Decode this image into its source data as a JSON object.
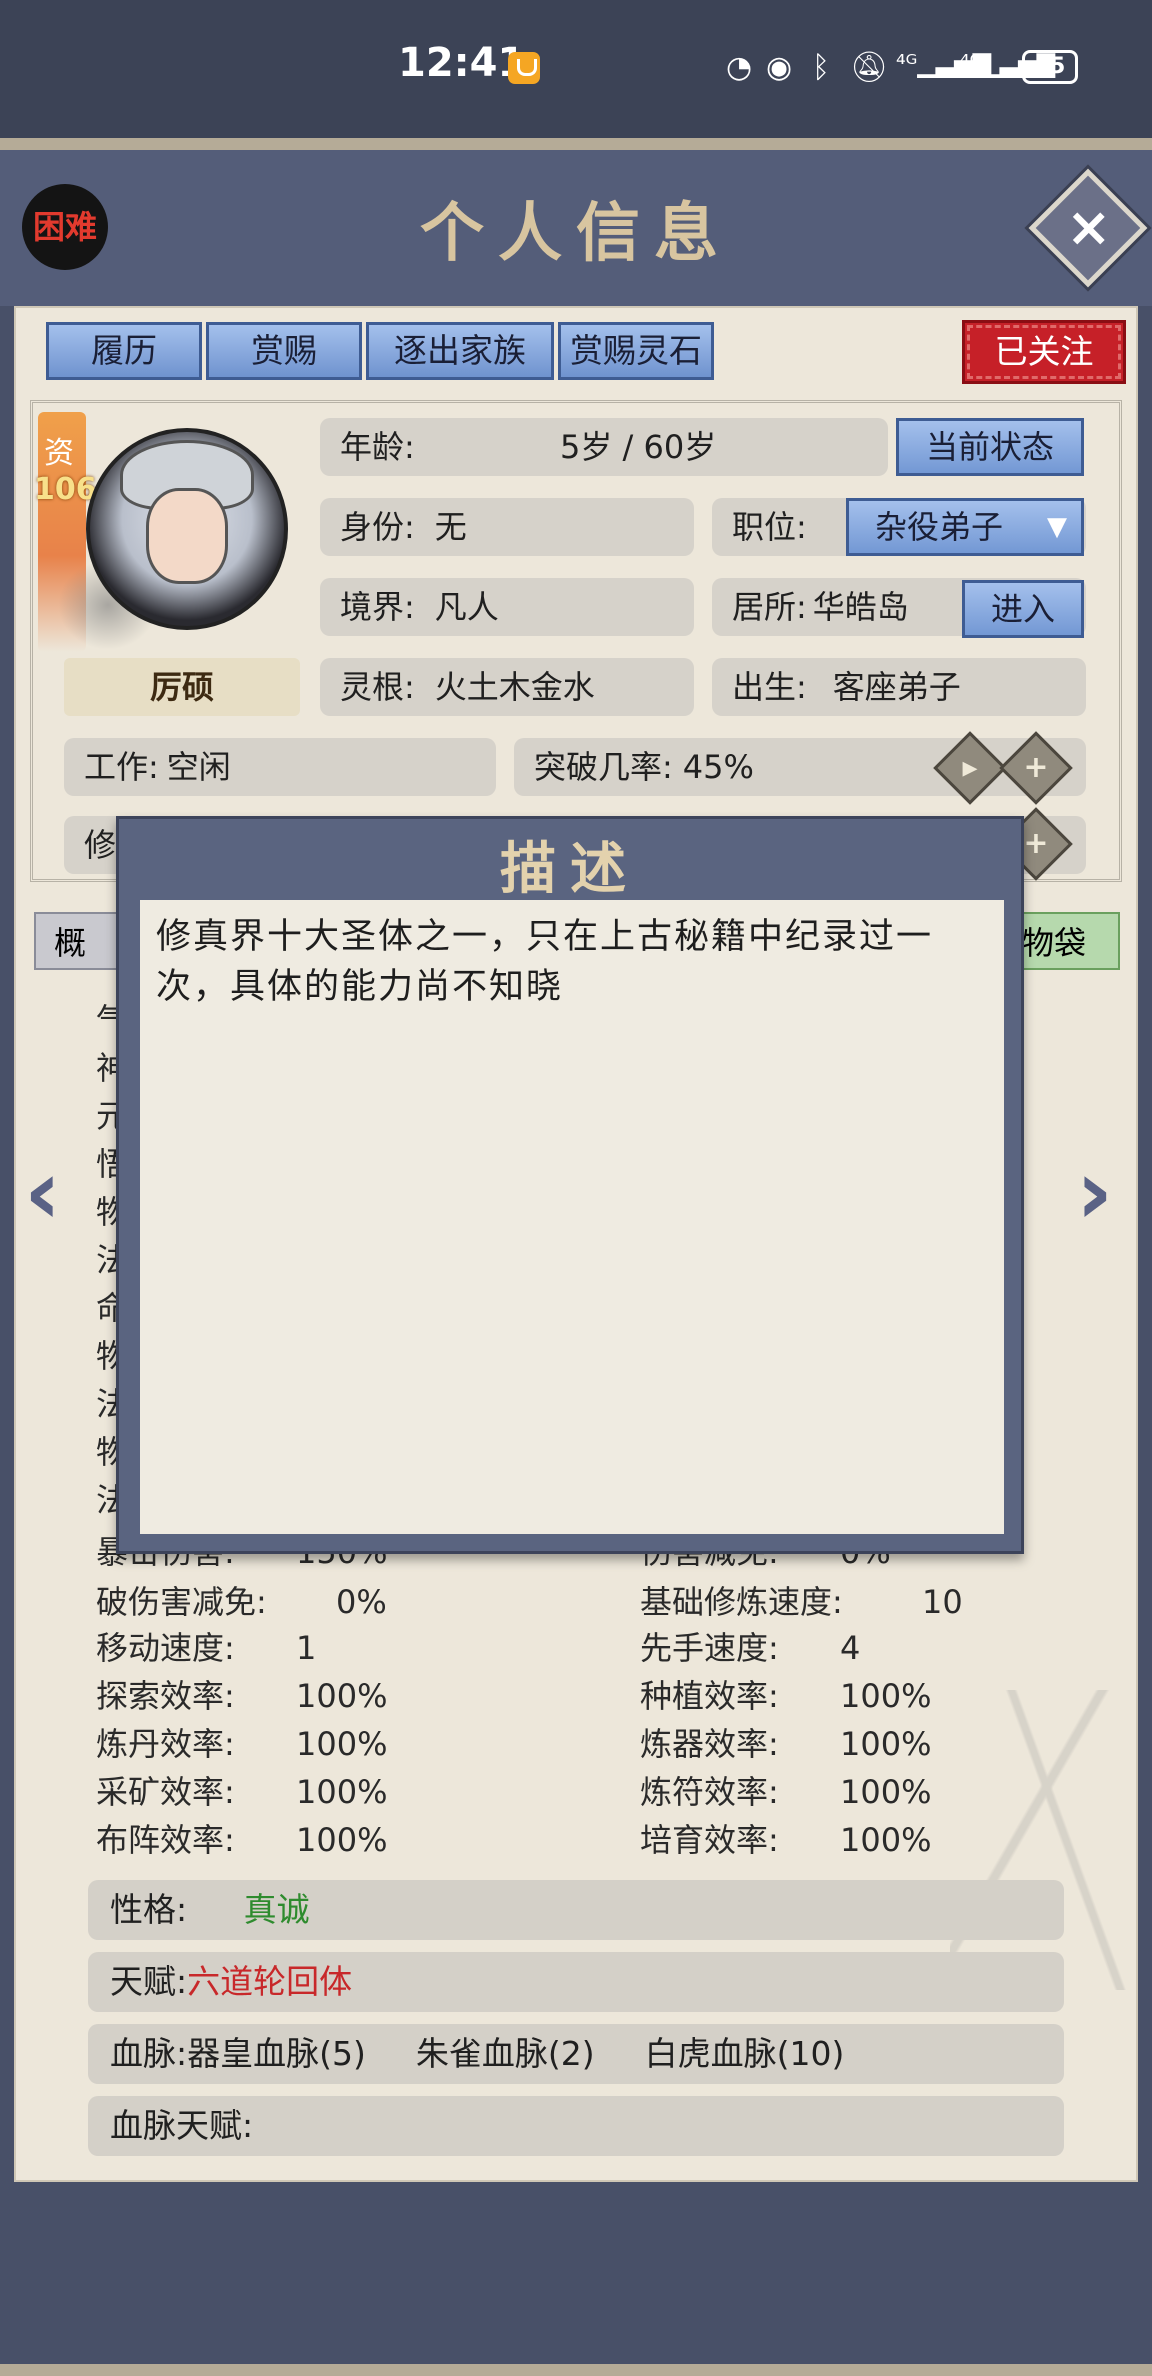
{
  "status_bar": {
    "time": "12:41",
    "battery": "65",
    "icons": [
      "speed-icon",
      "eye-icon",
      "bluetooth-icon",
      "mute-icon",
      "signal-4g-icon",
      "signal-4g-icon"
    ]
  },
  "header": {
    "title": "个人信息",
    "difficulty": "困难",
    "close_icon": "×"
  },
  "top_tabs": [
    "履历",
    "赏赐",
    "逐出家族",
    "赏赐灵石"
  ],
  "follow_button": "已关注",
  "character": {
    "aptitude_label": "资",
    "aptitude_value": "106",
    "trait_button": "厉硕",
    "age_label": "年龄:",
    "age_value": "5岁 / 60岁",
    "status_button": "当前状态",
    "identity_label": "身份:",
    "identity_value": "无",
    "position_label": "职位:",
    "position_value": "杂役弟子",
    "realm_label": "境界:",
    "realm_value": "凡人",
    "residence_label": "居所:",
    "residence_value": "华皓岛",
    "enter_button": "进入",
    "root_label": "灵根:",
    "root_value": "火土木金水",
    "birth_label": "出生:",
    "birth_value": "客座弟子",
    "work_label": "工作:",
    "work_value": "空闲",
    "breakthrough_label": "突破几率:",
    "breakthrough_value": "45%",
    "row6_label_partial": "修"
  },
  "lower_tabs": {
    "left_partial": "概",
    "right_partial": "物袋"
  },
  "stats_left_partial": [
    "气",
    "神",
    "元",
    "悟",
    "物",
    "法",
    "命",
    "物",
    "法",
    "物",
    "法"
  ],
  "stats": [
    {
      "l_label": "暴击伤害:",
      "l_value": "150%",
      "r_label": "伤害减免:",
      "r_value": "0%"
    },
    {
      "l_label": "破伤害减免:",
      "l_value": "0%",
      "r_label": "基础修炼速度:",
      "r_value": "10"
    },
    {
      "l_label": "移动速度:",
      "l_value": "1",
      "r_label": "先手速度:",
      "r_value": "4"
    },
    {
      "l_label": "探索效率:",
      "l_value": "100%",
      "r_label": "种植效率:",
      "r_value": "100%"
    },
    {
      "l_label": "炼丹效率:",
      "l_value": "100%",
      "r_label": "炼器效率:",
      "r_value": "100%"
    },
    {
      "l_label": "采矿效率:",
      "l_value": "100%",
      "r_label": "炼符效率:",
      "r_value": "100%"
    },
    {
      "l_label": "布阵效率:",
      "l_value": "100%",
      "r_label": "培育效率:",
      "r_value": "100%"
    }
  ],
  "bars": {
    "personality_label": "性格:",
    "personality_value": "真诚",
    "talent_label": "天赋:",
    "talent_value": "六道轮回体",
    "bloodline_label": "血脉:",
    "bloodline_1": "器皇血脉(5)",
    "bloodline_2": "朱雀血脉(2)",
    "bloodline_3": "白虎血脉(10)",
    "bloodline_talent_label": "血脉天赋:"
  },
  "modal": {
    "title": "描述",
    "text": "修真界十大圣体之一，只在上古秘籍中纪录过一次，具体的能力尚不知晓"
  },
  "colors": {
    "personality_value": "#2e8b2e",
    "talent_value": "#c8282a",
    "follow_bg": "#c62028",
    "button_blue": "#7398d4",
    "panel_bg": "#ede7da",
    "frame_bg": "#545d79"
  }
}
